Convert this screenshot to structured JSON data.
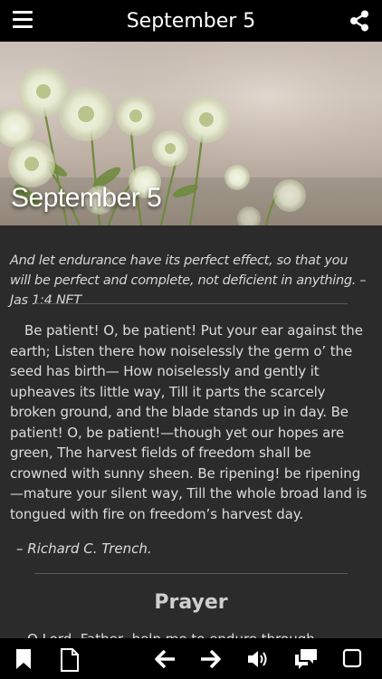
{
  "header": {
    "title": "September 5"
  },
  "hero": {
    "title": "September 5"
  },
  "verse": {
    "text": "And let endurance have its perfect effect, so that you will be perfect and complete, not deficient in anything. – Jas 1:4 NET"
  },
  "devotional": {
    "body": "Be patient! O, be patient! Put your ear against the earth; Listen there how noiselessly the germ o’ the seed has birth— How noiselessly and gently it upheaves its little way, Till it parts the scarcely broken ground, and the blade stands up in day. Be patient! O, be patient!—though yet our hopes are green, The harvest fields of freedom shall be crowned with sunny sheen. Be ripening! be ripening—mature your silent way, Till the whole broad land is tongued with fire on freedom’s harvest day.",
    "author": "– Richard C. Trench."
  },
  "prayer": {
    "heading": "Prayer",
    "peek": "O Lord, Father, help me to endure through"
  },
  "colors": {
    "bar_background": "#000000",
    "content_background": "#2b2b2b",
    "text": "#dcdcdc"
  },
  "icons": {
    "menu": "menu-icon",
    "share": "share-icon",
    "bookmark": "bookmark-icon",
    "document": "document-icon",
    "back": "arrow-left-icon",
    "forward": "arrow-right-icon",
    "audio": "speaker-icon",
    "comments": "chat-icon",
    "fullscreen": "square-icon"
  }
}
